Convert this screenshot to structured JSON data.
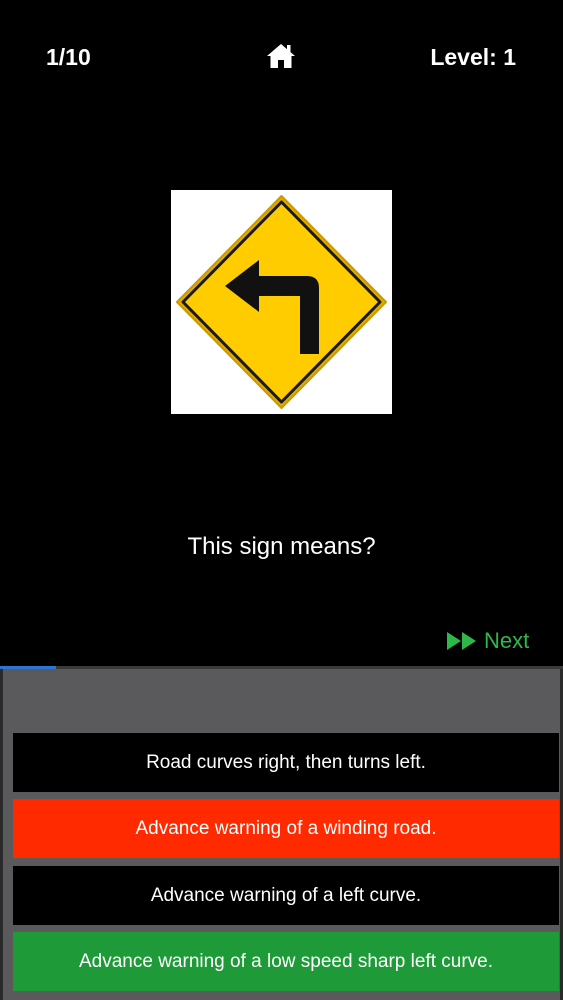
{
  "header": {
    "counter": "1/10",
    "level": "Level: 1",
    "home_icon": "home-icon"
  },
  "sign": {
    "icon": "left-turn-warning-sign",
    "color_yellow": "#FFCC00",
    "color_black": "#000000"
  },
  "question": "This sign means?",
  "next": {
    "label": "Next",
    "icon": "fast-forward-icon",
    "color": "#2fb84a"
  },
  "progress": {
    "value": 0.1,
    "color": "#2d74d6"
  },
  "answers": [
    {
      "label": "Road curves right, then turns left.",
      "state": "neutral",
      "color": "#000000"
    },
    {
      "label": "Advance warning of a winding road.",
      "state": "wrong",
      "color": "#ff2a00"
    },
    {
      "label": "Advance warning of a left curve.",
      "state": "neutral",
      "color": "#000000"
    },
    {
      "label": "Advance warning of a low speed sharp left curve.",
      "state": "correct",
      "color": "#1e9a38"
    }
  ]
}
